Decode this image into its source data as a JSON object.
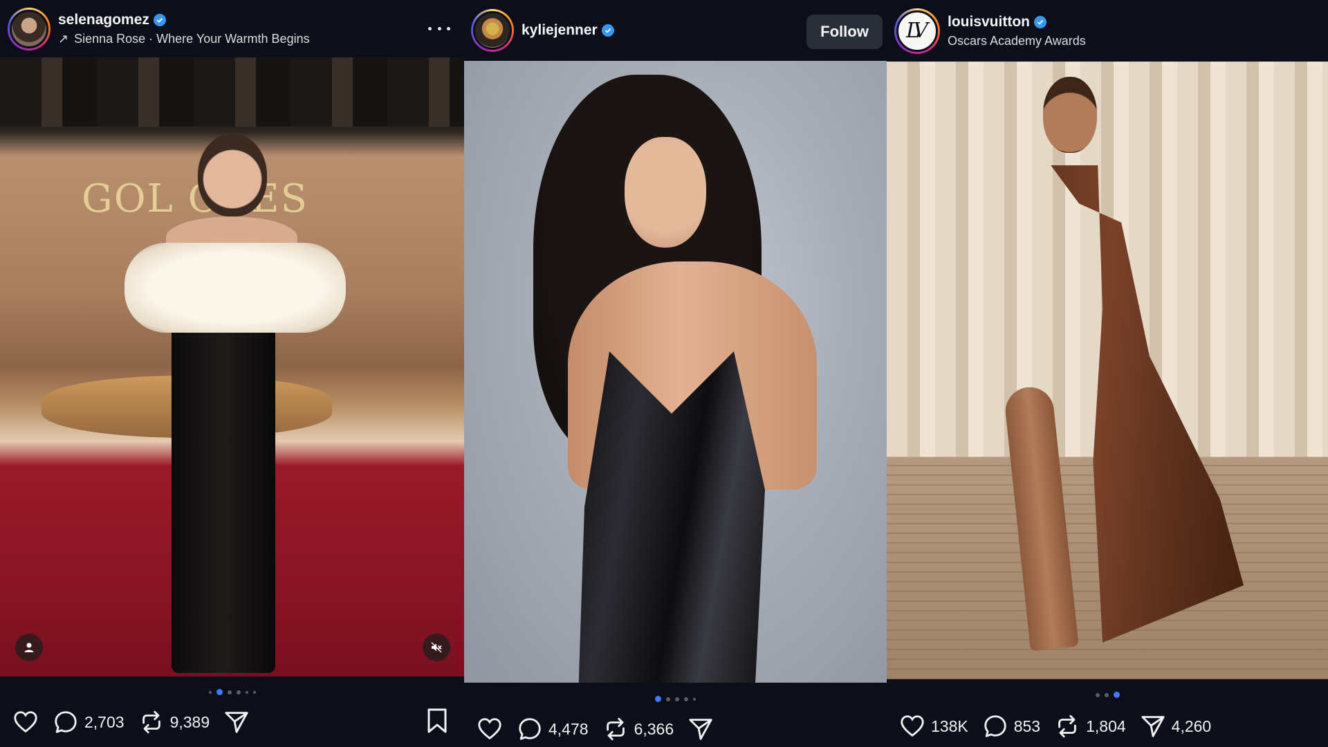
{
  "posts": [
    {
      "username": "selenagomez",
      "subtitle_arrow": "↗",
      "subtitle": "Sienna Rose · Where Your Warmth Begins",
      "image_text": "GOL        OBES",
      "counts": {
        "comments": "2,703",
        "reposts": "9,389"
      },
      "page": {
        "total": 6,
        "active": 1
      }
    },
    {
      "username": "kyliejenner",
      "follow_label": "Follow",
      "counts": {
        "comments": "4,478",
        "reposts": "6,366"
      },
      "page": {
        "total": 5,
        "active": 0
      }
    },
    {
      "username": "louisvuitton",
      "subtitle": "Oscars Academy Awards",
      "logo_text": "LV",
      "counts": {
        "likes": "138K",
        "comments": "853",
        "reposts": "1,804",
        "shares": "4,260"
      },
      "page": {
        "total": 3,
        "active": 2
      }
    }
  ],
  "colors": {
    "accent": "#3f7bff",
    "verified": "#3897f0",
    "background": "#0c0f1a"
  },
  "icons": [
    "heart-icon",
    "comment-icon",
    "repost-icon",
    "share-icon",
    "bookmark-icon",
    "more-icon",
    "verified-icon",
    "person-icon",
    "mute-icon"
  ]
}
